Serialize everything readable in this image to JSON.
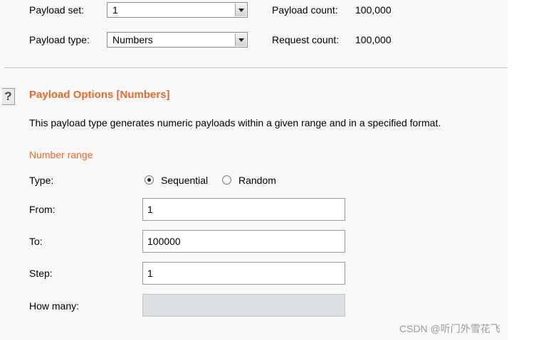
{
  "payload": {
    "set_label": "Payload set:",
    "set_value": "1",
    "type_label": "Payload type:",
    "type_value": "Numbers",
    "count_label": "Payload count:",
    "count_value": "100,000",
    "request_label": "Request count:",
    "request_value": "100,000"
  },
  "options": {
    "help_icon": "?",
    "title": "Payload Options [Numbers]",
    "description": "This payload type generates numeric payloads within a given range and in a specified format."
  },
  "number_range": {
    "title": "Number range",
    "type_label": "Type:",
    "radio_options": [
      "Sequential",
      "Random"
    ],
    "selected": "Sequential",
    "from_label": "From:",
    "from_value": "1",
    "to_label": "To:",
    "to_value": "100000",
    "step_label": "Step:",
    "step_value": "1",
    "how_many_label": "How many:",
    "how_many_value": ""
  },
  "watermark": "CSDN @听门外雪花飞",
  "colors": {
    "accent": "#e8692a"
  },
  "icons": {
    "help": "help-icon",
    "dropdown": "chevron-down-icon"
  }
}
